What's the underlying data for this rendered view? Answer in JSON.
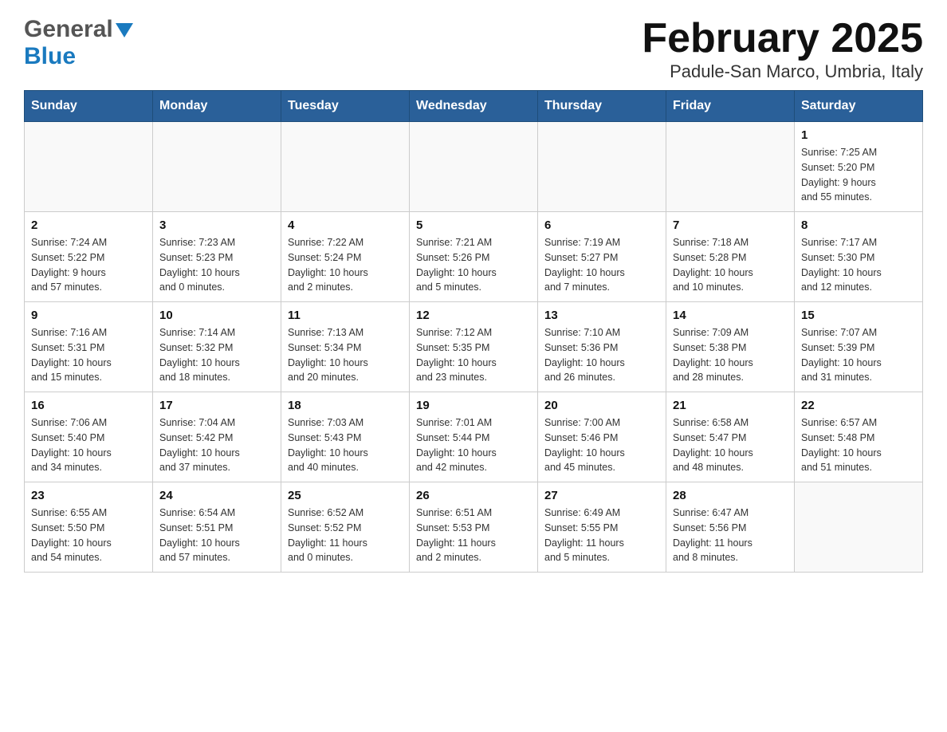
{
  "logo": {
    "general": "General",
    "blue": "Blue"
  },
  "title": "February 2025",
  "subtitle": "Padule-San Marco, Umbria, Italy",
  "weekdays": [
    "Sunday",
    "Monday",
    "Tuesday",
    "Wednesday",
    "Thursday",
    "Friday",
    "Saturday"
  ],
  "weeks": [
    {
      "days": [
        {
          "number": "",
          "info": ""
        },
        {
          "number": "",
          "info": ""
        },
        {
          "number": "",
          "info": ""
        },
        {
          "number": "",
          "info": ""
        },
        {
          "number": "",
          "info": ""
        },
        {
          "number": "",
          "info": ""
        },
        {
          "number": "1",
          "info": "Sunrise: 7:25 AM\nSunset: 5:20 PM\nDaylight: 9 hours\nand 55 minutes."
        }
      ]
    },
    {
      "days": [
        {
          "number": "2",
          "info": "Sunrise: 7:24 AM\nSunset: 5:22 PM\nDaylight: 9 hours\nand 57 minutes."
        },
        {
          "number": "3",
          "info": "Sunrise: 7:23 AM\nSunset: 5:23 PM\nDaylight: 10 hours\nand 0 minutes."
        },
        {
          "number": "4",
          "info": "Sunrise: 7:22 AM\nSunset: 5:24 PM\nDaylight: 10 hours\nand 2 minutes."
        },
        {
          "number": "5",
          "info": "Sunrise: 7:21 AM\nSunset: 5:26 PM\nDaylight: 10 hours\nand 5 minutes."
        },
        {
          "number": "6",
          "info": "Sunrise: 7:19 AM\nSunset: 5:27 PM\nDaylight: 10 hours\nand 7 minutes."
        },
        {
          "number": "7",
          "info": "Sunrise: 7:18 AM\nSunset: 5:28 PM\nDaylight: 10 hours\nand 10 minutes."
        },
        {
          "number": "8",
          "info": "Sunrise: 7:17 AM\nSunset: 5:30 PM\nDaylight: 10 hours\nand 12 minutes."
        }
      ]
    },
    {
      "days": [
        {
          "number": "9",
          "info": "Sunrise: 7:16 AM\nSunset: 5:31 PM\nDaylight: 10 hours\nand 15 minutes."
        },
        {
          "number": "10",
          "info": "Sunrise: 7:14 AM\nSunset: 5:32 PM\nDaylight: 10 hours\nand 18 minutes."
        },
        {
          "number": "11",
          "info": "Sunrise: 7:13 AM\nSunset: 5:34 PM\nDaylight: 10 hours\nand 20 minutes."
        },
        {
          "number": "12",
          "info": "Sunrise: 7:12 AM\nSunset: 5:35 PM\nDaylight: 10 hours\nand 23 minutes."
        },
        {
          "number": "13",
          "info": "Sunrise: 7:10 AM\nSunset: 5:36 PM\nDaylight: 10 hours\nand 26 minutes."
        },
        {
          "number": "14",
          "info": "Sunrise: 7:09 AM\nSunset: 5:38 PM\nDaylight: 10 hours\nand 28 minutes."
        },
        {
          "number": "15",
          "info": "Sunrise: 7:07 AM\nSunset: 5:39 PM\nDaylight: 10 hours\nand 31 minutes."
        }
      ]
    },
    {
      "days": [
        {
          "number": "16",
          "info": "Sunrise: 7:06 AM\nSunset: 5:40 PM\nDaylight: 10 hours\nand 34 minutes."
        },
        {
          "number": "17",
          "info": "Sunrise: 7:04 AM\nSunset: 5:42 PM\nDaylight: 10 hours\nand 37 minutes."
        },
        {
          "number": "18",
          "info": "Sunrise: 7:03 AM\nSunset: 5:43 PM\nDaylight: 10 hours\nand 40 minutes."
        },
        {
          "number": "19",
          "info": "Sunrise: 7:01 AM\nSunset: 5:44 PM\nDaylight: 10 hours\nand 42 minutes."
        },
        {
          "number": "20",
          "info": "Sunrise: 7:00 AM\nSunset: 5:46 PM\nDaylight: 10 hours\nand 45 minutes."
        },
        {
          "number": "21",
          "info": "Sunrise: 6:58 AM\nSunset: 5:47 PM\nDaylight: 10 hours\nand 48 minutes."
        },
        {
          "number": "22",
          "info": "Sunrise: 6:57 AM\nSunset: 5:48 PM\nDaylight: 10 hours\nand 51 minutes."
        }
      ]
    },
    {
      "days": [
        {
          "number": "23",
          "info": "Sunrise: 6:55 AM\nSunset: 5:50 PM\nDaylight: 10 hours\nand 54 minutes."
        },
        {
          "number": "24",
          "info": "Sunrise: 6:54 AM\nSunset: 5:51 PM\nDaylight: 10 hours\nand 57 minutes."
        },
        {
          "number": "25",
          "info": "Sunrise: 6:52 AM\nSunset: 5:52 PM\nDaylight: 11 hours\nand 0 minutes."
        },
        {
          "number": "26",
          "info": "Sunrise: 6:51 AM\nSunset: 5:53 PM\nDaylight: 11 hours\nand 2 minutes."
        },
        {
          "number": "27",
          "info": "Sunrise: 6:49 AM\nSunset: 5:55 PM\nDaylight: 11 hours\nand 5 minutes."
        },
        {
          "number": "28",
          "info": "Sunrise: 6:47 AM\nSunset: 5:56 PM\nDaylight: 11 hours\nand 8 minutes."
        },
        {
          "number": "",
          "info": ""
        }
      ]
    }
  ]
}
